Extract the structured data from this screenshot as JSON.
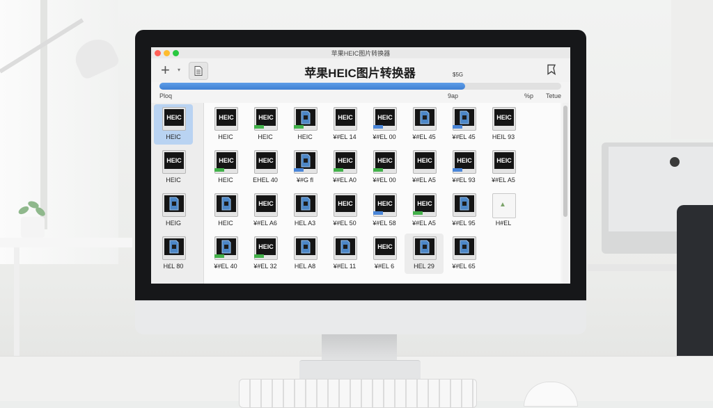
{
  "window": {
    "title": "苹果HEIC图片转换器"
  },
  "toolbar": {
    "add_label": "+",
    "app_title": "苹果HEIC图片转换器",
    "size_label": "$5G"
  },
  "progress": {
    "fraction": 0.76
  },
  "columns": [
    "Ploq",
    "9ap",
    "%p",
    "Tetue"
  ],
  "sidebar_items": [
    {
      "label": "HEIC",
      "thumb": "HEIC",
      "variant": "dark",
      "selected": true
    },
    {
      "label": "HEIC",
      "thumb": "HEIC",
      "variant": "dark"
    },
    {
      "label": "HEIG",
      "thumb": "",
      "variant": "icon"
    },
    {
      "label": "H£L 80",
      "thumb": "",
      "variant": "icon"
    }
  ],
  "grid_items": [
    {
      "label": "HEIC",
      "thumb": "HEIC",
      "variant": "dark"
    },
    {
      "label": "HEIC",
      "thumb": "HEIC",
      "variant": "dark",
      "bar": "green"
    },
    {
      "label": "HEIC",
      "thumb": "",
      "variant": "icon",
      "bar": "green"
    },
    {
      "label": "¥#EL 14",
      "thumb": "HEIC",
      "variant": "dark"
    },
    {
      "label": "¥#EL 00",
      "thumb": "HEIC",
      "variant": "dark",
      "bar": "blue"
    },
    {
      "label": "¥#EL 45",
      "thumb": "",
      "variant": "icon"
    },
    {
      "label": "¥#EL 45",
      "thumb": "",
      "variant": "icon",
      "bar": "blue"
    },
    {
      "label": "HEIL 93",
      "thumb": "HEIC",
      "variant": "dark"
    },
    {
      "label": "HEIC",
      "thumb": "HEIC",
      "variant": "dark",
      "bar": "green"
    },
    {
      "label": "EHEL 40",
      "thumb": "HEIC",
      "variant": "dark"
    },
    {
      "label": "¥#G fl",
      "thumb": "",
      "variant": "icon",
      "bar": "blue"
    },
    {
      "label": "¥#EL A0",
      "thumb": "HEIC",
      "variant": "dark",
      "bar": "green"
    },
    {
      "label": "¥#EL 00",
      "thumb": "HEIC",
      "variant": "dark",
      "bar": "green"
    },
    {
      "label": "¥#EL A5",
      "thumb": "HEIC",
      "variant": "dark"
    },
    {
      "label": "¥#EL 93",
      "thumb": "HEIC",
      "variant": "dark",
      "bar": "blue"
    },
    {
      "label": "¥#EL A5",
      "thumb": "HEIC",
      "variant": "dark"
    },
    {
      "label": "HEIC",
      "thumb": "",
      "variant": "icon"
    },
    {
      "label": "¥#EL A6",
      "thumb": "HEIC",
      "variant": "dark"
    },
    {
      "label": "HEL A3",
      "thumb": "",
      "variant": "icon"
    },
    {
      "label": "¥#EL 50",
      "thumb": "HEIC",
      "variant": "dark"
    },
    {
      "label": "¥#EL 58",
      "thumb": "HEIC",
      "variant": "dark",
      "bar": "blue"
    },
    {
      "label": "¥#EL A5",
      "thumb": "HEIC",
      "variant": "dark",
      "bar": "green"
    },
    {
      "label": "¥#EL 95",
      "thumb": "",
      "variant": "icon"
    },
    {
      "label": "H#EL",
      "thumb": "",
      "variant": "generic"
    },
    {
      "label": "¥#EL 40",
      "thumb": "",
      "variant": "icon",
      "bar": "green"
    },
    {
      "label": "¥#EL 32",
      "thumb": "HEIC",
      "variant": "dark",
      "bar": "green"
    },
    {
      "label": "HEL A8",
      "thumb": "",
      "variant": "icon"
    },
    {
      "label": "¥#EL 11",
      "thumb": "",
      "variant": "icon"
    },
    {
      "label": "¥#EL 6",
      "thumb": "HEIC",
      "variant": "dark"
    },
    {
      "label": "HEL 29",
      "thumb": "",
      "variant": "icon",
      "hover": true
    },
    {
      "label": "¥#EL 65",
      "thumb": "",
      "variant": "icon"
    }
  ]
}
